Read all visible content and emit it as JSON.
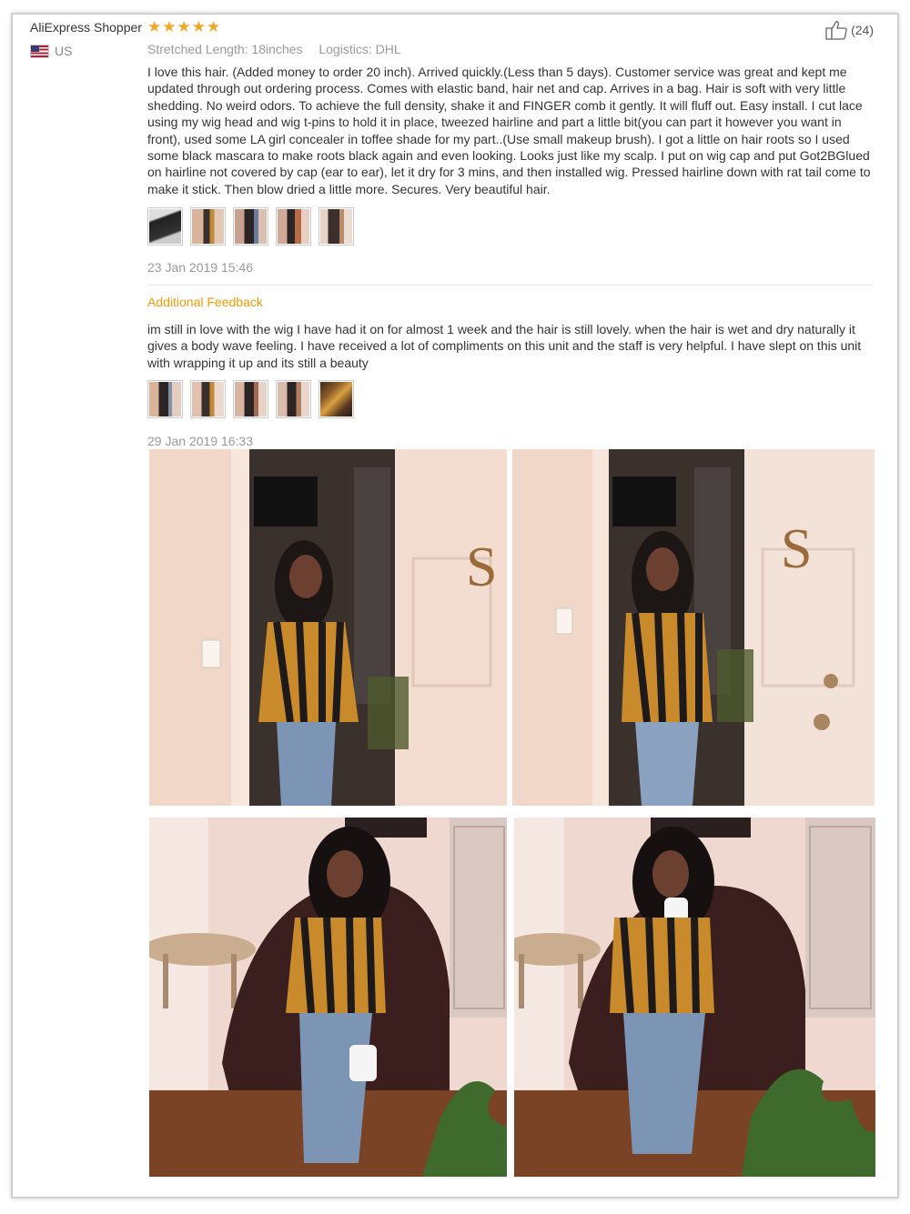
{
  "review": {
    "user_name": "AliExpress Shopper",
    "country": "US",
    "stars": [
      "★",
      "★",
      "★",
      "★",
      "★"
    ],
    "stretched_length": "Stretched Length: 18inches",
    "logistics": "Logistics: DHL",
    "helpful_count": "(24)",
    "text": "I love this hair. (Added money to order 20 inch). Arrived quickly.(Less than 5 days). Customer service was great and kept me updated through out ordering process. Comes with elastic band, hair net and cap. Arrives in a bag. Hair is soft with very little shedding. No weird odors. To achieve the full density, shake it and FINGER comb it gently. It will fluff out. Easy install. I cut lace using my wig head and wig t-pins to hold it in place, tweezed hairline and part a little bit(you can part it however you want in front), used some LA girl concealer in toffee shade for my part..(Use small makeup brush). I got a little on hair roots so I used some black mascara to make roots black again and even looking. Looks just like my scalp. I put on wig cap and put Got2BGlued on hairline not covered by cap (ear to ear), let it dry for 3 mins, and then installed wig. Pressed hairline down with rat tail come to make it stick. Then blow dried a little more. Secures. Very beautiful hair.",
    "date": "23 Jan 2019 15:46"
  },
  "additional": {
    "heading": "Additional Feedback",
    "text": "im still in love with the wig I have had it on for almost 1 week and the hair is still lovely. when the hair is wet and dry naturally it gives a body wave feeling. I have received a lot of compliments on this unit and the staff is very helpful. I have slept on this unit with wrapping it up and its still a beauty",
    "date": "29 Jan 2019 16:33"
  },
  "icons": {
    "flag": "us-flag-icon",
    "helpful": "thumbs-up-icon",
    "rating": "star-icon"
  },
  "colors": {
    "star": "#f5a623",
    "additional_heading": "#f39800",
    "muted_text": "#999999",
    "body_text": "#333333"
  }
}
